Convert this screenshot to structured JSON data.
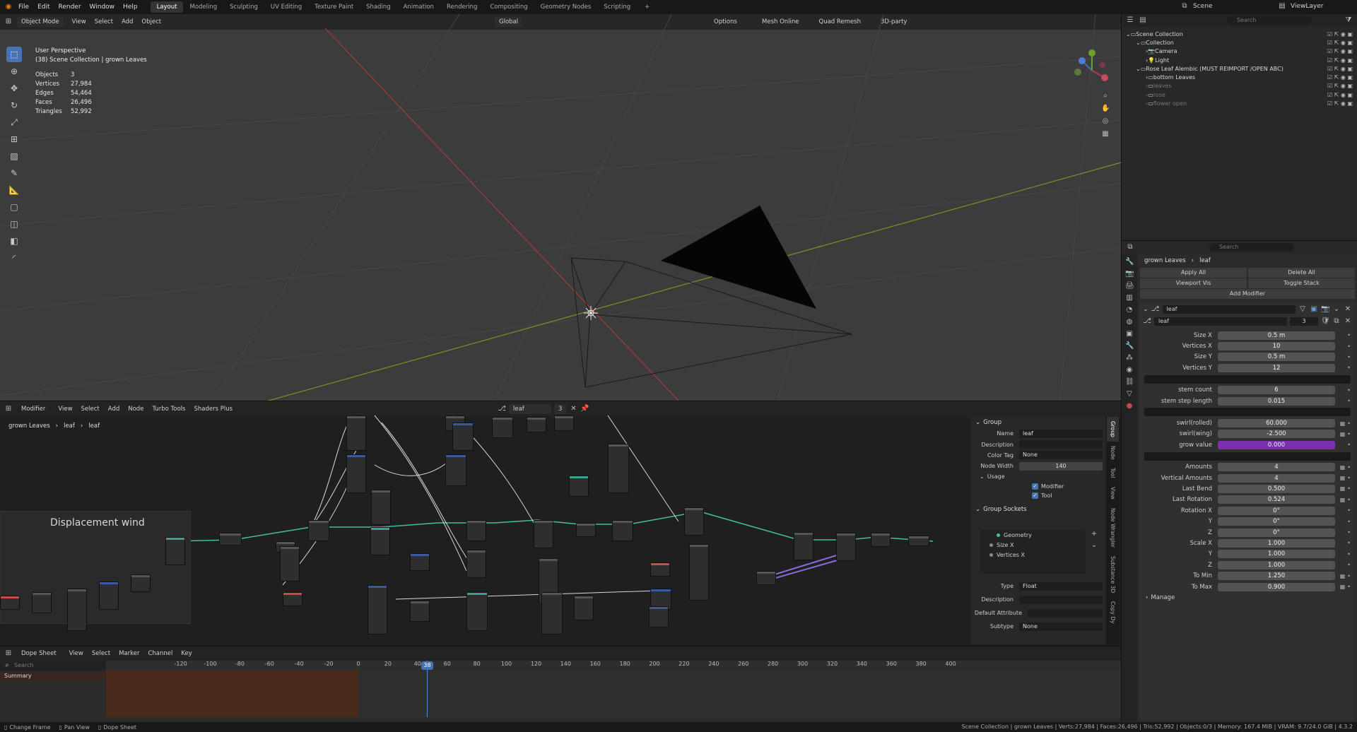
{
  "topbar": {
    "menus": [
      "File",
      "Edit",
      "Render",
      "Window",
      "Help"
    ],
    "workspaces": [
      "Layout",
      "Modeling",
      "Sculpting",
      "UV Editing",
      "Texture Paint",
      "Shading",
      "Animation",
      "Rendering",
      "Compositing",
      "Geometry Nodes",
      "Scripting"
    ],
    "scene_label": "Scene",
    "viewlayer_label": "ViewLayer"
  },
  "viewport": {
    "mode": "Object Mode",
    "menus": [
      "View",
      "Select",
      "Add",
      "Object"
    ],
    "transform": "Global",
    "options": "Options",
    "addons": [
      "Mesh Online",
      "Quad Remesh",
      "3D-party"
    ],
    "perspective": "User Perspective",
    "collection": "(38) Scene Collection | grown Leaves",
    "stats": [
      {
        "label": "Objects",
        "value": "3"
      },
      {
        "label": "Vertices",
        "value": "27,984"
      },
      {
        "label": "Edges",
        "value": "54,464"
      },
      {
        "label": "Faces",
        "value": "26,496"
      },
      {
        "label": "Triangles",
        "value": "52,992"
      }
    ]
  },
  "node_editor": {
    "editor_type": "Modifier",
    "menus": [
      "View",
      "Select",
      "Add",
      "Node",
      "Turbo Tools",
      "Shaders Plus"
    ],
    "tree_name": "leaf",
    "users": "3",
    "breadcrumb": [
      "grown Leaves",
      "leaf",
      "leaf"
    ],
    "frame_label": "Displacement wind",
    "side_tabs": [
      "Group",
      "Node",
      "Tool",
      "View",
      "Node Wrangler",
      "Substance 3D",
      "Copy Dy"
    ],
    "group": {
      "header": "Group",
      "name_label": "Name",
      "name_value": "leaf",
      "description_label": "Description",
      "color_tag_label": "Color Tag",
      "color_tag_value": "None",
      "node_width_label": "Node Width",
      "node_width_value": "140",
      "usage_header": "Usage",
      "usage_modifier": "Modifier",
      "usage_tool": "Tool",
      "sockets_header": "Group Sockets",
      "sockets": [
        "Geometry",
        "Size X",
        "Vertices X"
      ],
      "type_label": "Type",
      "type_value": "Float",
      "desc2_label": "Description",
      "default_attr_label": "Default Attribute",
      "subtype_label": "Subtype",
      "subtype_value": "None"
    }
  },
  "dopesheet": {
    "editor": "Dope Sheet",
    "menus": [
      "View",
      "Select",
      "Marker",
      "Channel",
      "Key"
    ],
    "search_placeholder": "Search",
    "summary": "Summary",
    "current_frame": "38",
    "ticks": [
      "-120",
      "-100",
      "-80",
      "-60",
      "-40",
      "-20",
      "0",
      "20",
      "40",
      "60",
      "80",
      "100",
      "120",
      "140",
      "160",
      "180",
      "200",
      "220",
      "240",
      "260",
      "280",
      "300",
      "320",
      "340",
      "360",
      "380",
      "400"
    ]
  },
  "statusbar": {
    "left": [
      "Change Frame",
      "Pan View",
      "Dope Sheet"
    ],
    "right": "Scene Collection | grown Leaves | Verts:27,984 | Faces:26,496 | Tris:52,992 | Objects:0/3 | Memory: 167.4 MiB | VRAM: 9.7/24.0 GiB | 4.3.2"
  },
  "outliner": {
    "search_placeholder": "Search",
    "items": [
      {
        "label": "Scene Collection",
        "indent": 0
      },
      {
        "label": "Collection",
        "indent": 1
      },
      {
        "label": "Camera",
        "indent": 2
      },
      {
        "label": "Light",
        "indent": 2
      },
      {
        "label": "Rose Leaf Alembic (MUST REIMPORT /OPEN ABC)",
        "indent": 1
      },
      {
        "label": "bottom Leaves",
        "indent": 2
      },
      {
        "label": "leaves",
        "indent": 2
      },
      {
        "label": "rose",
        "indent": 2
      },
      {
        "label": "flower open",
        "indent": 2
      }
    ]
  },
  "properties": {
    "search_placeholder": "Search",
    "breadcrumb": [
      "grown Leaves",
      "leaf"
    ],
    "apply_all": "Apply All",
    "delete_all": "Delete All",
    "viewport_vis": "Viewport Vis",
    "toggle_stack": "Toggle Stack",
    "add_modifier": "Add Modifier",
    "modifier_name": "leaf",
    "node_group": "leaf",
    "node_group_users": "3",
    "fields": [
      {
        "label": "Size X",
        "value": "0.5 m"
      },
      {
        "label": "Vertices X",
        "value": "10"
      },
      {
        "label": "Size Y",
        "value": "0.5 m"
      },
      {
        "label": "Vertices Y",
        "value": "12"
      },
      {
        "sep": true
      },
      {
        "label": "stem count",
        "value": "6"
      },
      {
        "label": "stem step length",
        "value": "0.015"
      },
      {
        "sep": true
      },
      {
        "label": "swirl(rolled)",
        "value": "60.000",
        "extra": true
      },
      {
        "label": "swirl(wing)",
        "value": "-2.500",
        "extra": true
      },
      {
        "label": "grow value",
        "value": "0.000",
        "purple": true
      },
      {
        "sep": true
      },
      {
        "label": "Amounts",
        "value": "4",
        "extra": true
      },
      {
        "label": "Vertical Amounts",
        "value": "4",
        "extra": true
      },
      {
        "label": "Last Bend",
        "value": "0.500",
        "extra": true
      },
      {
        "label": "Last Rotation",
        "value": "0.524",
        "extra": true
      },
      {
        "label": "Rotation X",
        "value": "0°"
      },
      {
        "label": "Y",
        "value": "0°"
      },
      {
        "label": "Z",
        "value": "0°"
      },
      {
        "label": "Scale X",
        "value": "1.000"
      },
      {
        "label": "Y",
        "value": "1.000"
      },
      {
        "label": "Z",
        "value": "1.000"
      },
      {
        "label": "To Min",
        "value": "1.250",
        "extra": true
      },
      {
        "label": "To Max",
        "value": "0.900",
        "extra": true
      }
    ],
    "manage": "Manage"
  }
}
